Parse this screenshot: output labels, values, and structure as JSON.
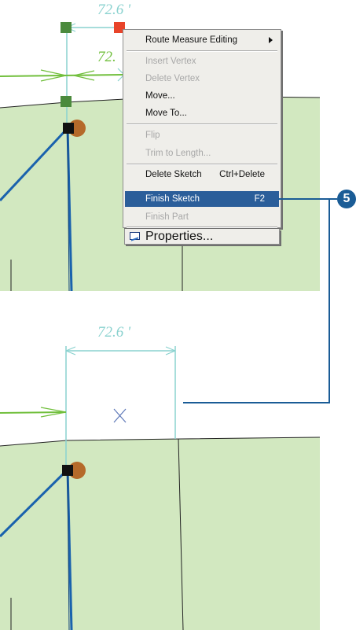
{
  "top_view": {
    "dimension_label": "72.6 '",
    "secondary_dimension_label": "72."
  },
  "context_menu": {
    "items": [
      {
        "label": "Route Measure Editing",
        "enabled": true,
        "submenu": true
      },
      {
        "label": "Insert Vertex",
        "enabled": false
      },
      {
        "label": "Delete Vertex",
        "enabled": false
      },
      {
        "label": "Move...",
        "enabled": true
      },
      {
        "label": "Move To...",
        "enabled": true
      },
      {
        "label": "Flip",
        "enabled": false
      },
      {
        "label": "Trim to Length...",
        "enabled": false
      },
      {
        "label": "Delete Sketch",
        "shortcut": "Ctrl+Delete",
        "enabled": true
      },
      {
        "label": "Finish Sketch",
        "shortcut": "F2",
        "enabled": true,
        "highlighted": true
      },
      {
        "label": "Finish Part",
        "enabled": false
      },
      {
        "label": "Properties...",
        "enabled": true,
        "icon": "properties-icon"
      }
    ]
  },
  "bottom_view": {
    "dimension_label": "72.6 '"
  },
  "callout": {
    "step_number": "5"
  },
  "colors": {
    "parcel_fill": "#d2e8c0",
    "sketch_line": "#1a62ad",
    "measure_line": "#8ad2cf",
    "direction_arrow": "#71bf3c",
    "vertex_green": "#4b8a3d",
    "vertex_selected": "#e8442a",
    "point_feature": "#b56a2a",
    "menu_highlight": "#2b5e9a",
    "callout": "#1a5c96"
  }
}
